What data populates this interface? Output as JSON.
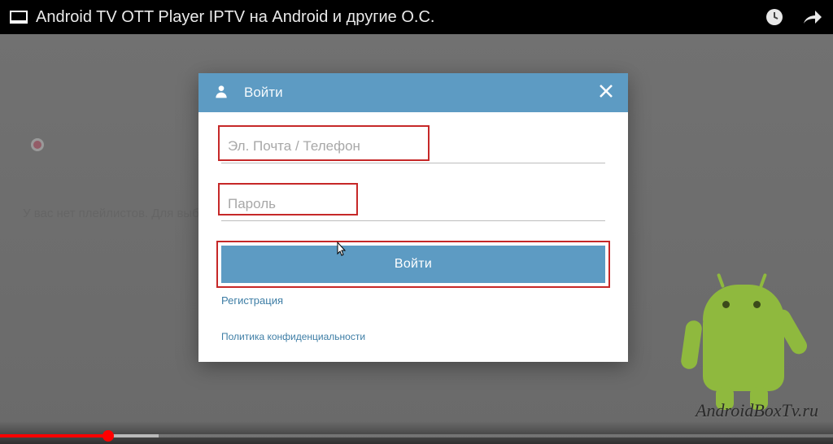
{
  "titlebar": {
    "title": "Android TV OTT Player IPTV на Android и другие О.С."
  },
  "background": {
    "playlist_hint": "У вас нет плейлистов. Для выб"
  },
  "modal": {
    "header_title": "Войти",
    "email_placeholder": "Эл. Почта / Телефон",
    "password_placeholder": "Пароль",
    "login_button": "Войти",
    "register_link": "Регистрация",
    "privacy_link": "Политика конфиденциальности"
  },
  "watermark": "AndroidBoxTv.ru",
  "progress": {
    "played_percent": 13,
    "buffered_percent": 19
  },
  "colors": {
    "modal_accent": "#5d9bc3",
    "highlight_red": "#c62828",
    "youtube_red": "#ff0000",
    "android_green": "#8fb93e"
  }
}
